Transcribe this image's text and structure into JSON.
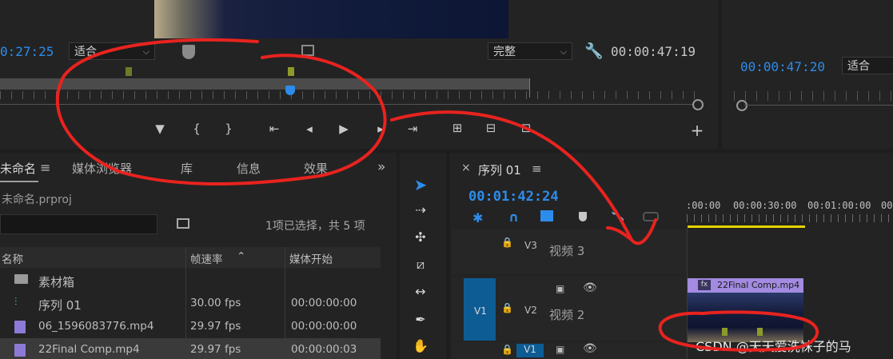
{
  "source_monitor": {
    "timecode_left": "0:27:25",
    "fit_select": "适合",
    "quality_select": "完整",
    "timecode_right": "00:00:47:19",
    "controls": {
      "add_marker": "▼",
      "mark_in": "{",
      "mark_out": "}",
      "go_to_in": "⇤",
      "step_back": "◂",
      "play": "▶",
      "step_forward": "▸",
      "go_to_out": "⇥",
      "insert": "⊞",
      "overwrite": "⊟",
      "export_frame": "⊡",
      "add": "+"
    }
  },
  "program_monitor": {
    "timecode": "00:00:47:20",
    "fit_select": "适合"
  },
  "project_panel": {
    "tabs": [
      "未命名",
      "媒体浏览器",
      "库",
      "信息",
      "效果"
    ],
    "menu_icon": "≡",
    "more_icon": "»",
    "project_file": "未命名.prproj",
    "selection_info": "1项已选择，共 5 项",
    "columns": [
      "名称",
      "帧速率",
      "媒体开始"
    ],
    "items": [
      {
        "name": "素材箱",
        "fps": "",
        "start": "",
        "icon": "folder-icon"
      },
      {
        "name": "序列 01",
        "fps": "30.00 fps",
        "start": "00:00:00:00",
        "icon": "sequence-icon"
      },
      {
        "name": "06_1596083776.mp4",
        "fps": "29.97 fps",
        "start": "00:00:00:00",
        "icon": "video-clip-icon"
      },
      {
        "name": "22Final Comp.mp4",
        "fps": "29.97 fps",
        "start": "00:00:00:03",
        "icon": "video-clip-icon"
      }
    ]
  },
  "timeline": {
    "close": "×",
    "sequence_name": "序列 01",
    "menu_icon": "≡",
    "timecode": "00:01:42:24",
    "ruler": [
      ":00:00",
      "00:00:30:00",
      "00:01:00:00",
      "00:0"
    ],
    "tracks": [
      {
        "source": "",
        "target": "V3",
        "name": "视频 3"
      },
      {
        "source": "V1",
        "target": "V2",
        "name": "视频 2"
      },
      {
        "source": "",
        "target": "V1",
        "name": ""
      }
    ],
    "clip_label": "22Final Comp.mp4",
    "clip_fx": "fx"
  },
  "watermark": "CSDN @天天爱洗袜子的马",
  "colors": {
    "accent": "#2d8ceb",
    "annotation": "#e8231f",
    "clip": "#a28be0",
    "work_area": "#e3d400"
  }
}
